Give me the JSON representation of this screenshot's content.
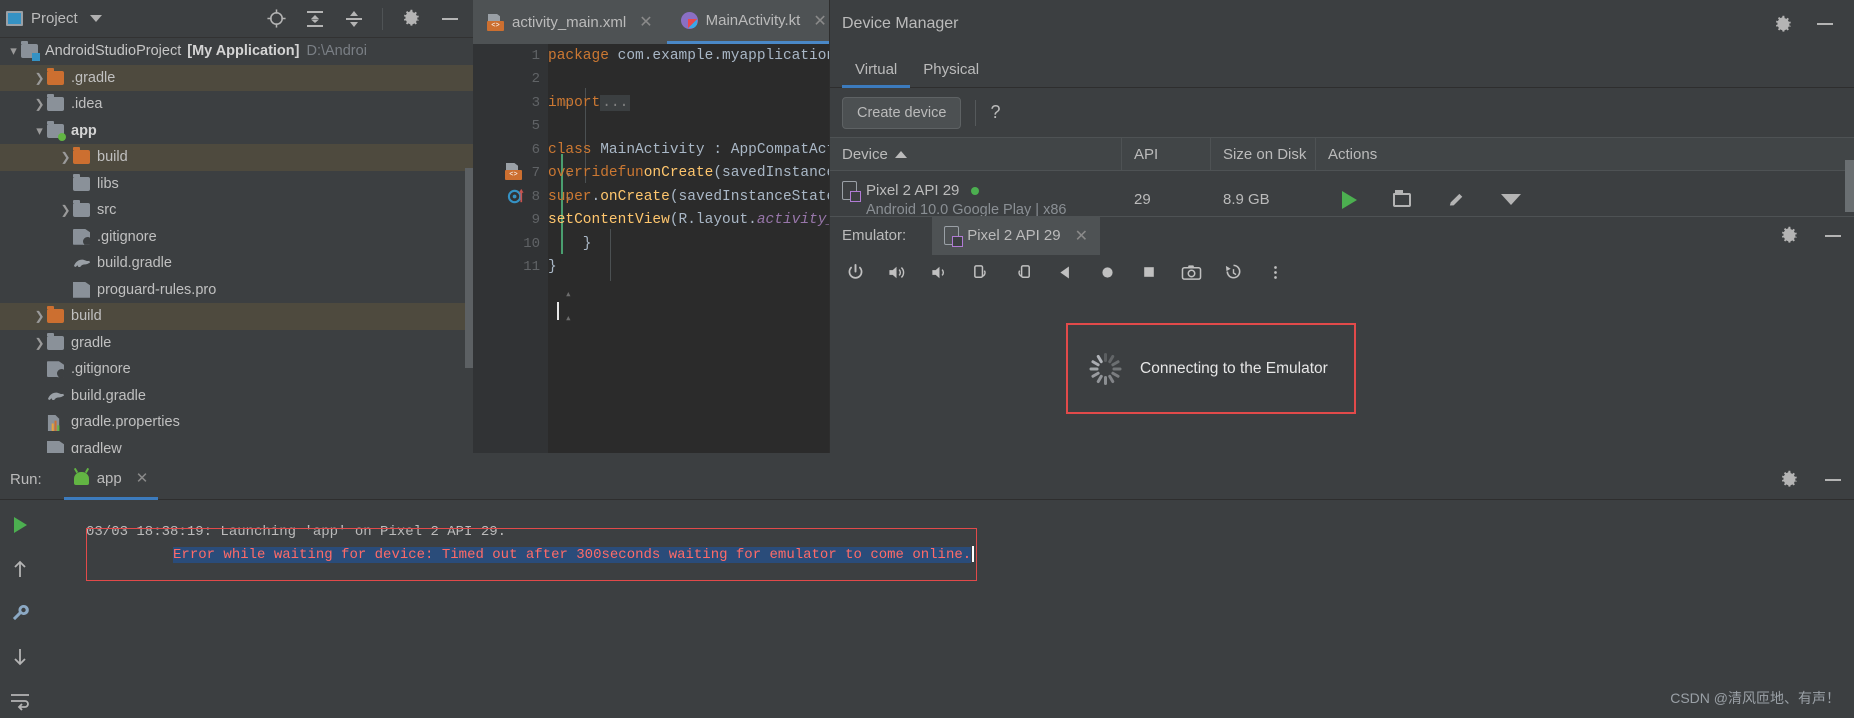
{
  "project_panel": {
    "title": "Project",
    "toolbar_icons": [
      "locate-icon",
      "expand-all-icon",
      "collapse-all-icon",
      "gear-icon",
      "minimize-icon"
    ],
    "root": {
      "name": "AndroidStudioProject",
      "app_name": "[My Application]",
      "path": "D:\\Androi"
    },
    "tree": [
      {
        "label": ".gradle",
        "indent": 1,
        "icon": "folder-orange",
        "arrow": "right",
        "selected": true
      },
      {
        "label": ".idea",
        "indent": 1,
        "icon": "folder-grey",
        "arrow": "right",
        "selected": false
      },
      {
        "label": "app",
        "indent": 1,
        "icon": "folder-grey-green",
        "arrow": "down",
        "selected": false,
        "bold": true
      },
      {
        "label": "build",
        "indent": 2,
        "icon": "folder-orange",
        "arrow": "right",
        "selected": true
      },
      {
        "label": "libs",
        "indent": 2,
        "icon": "folder-grey",
        "arrow": "none",
        "selected": false
      },
      {
        "label": "src",
        "indent": 2,
        "icon": "folder-grey",
        "arrow": "right",
        "selected": false
      },
      {
        "label": ".gitignore",
        "indent": 2,
        "icon": "file-git",
        "arrow": "none",
        "selected": false
      },
      {
        "label": "build.gradle",
        "indent": 2,
        "icon": "file-gradle",
        "arrow": "none",
        "selected": false
      },
      {
        "label": "proguard-rules.pro",
        "indent": 2,
        "icon": "file-doc",
        "arrow": "none",
        "selected": false
      },
      {
        "label": "build",
        "indent": 1,
        "icon": "folder-orange",
        "arrow": "right",
        "selected": true
      },
      {
        "label": "gradle",
        "indent": 1,
        "icon": "folder-grey",
        "arrow": "right",
        "selected": false
      },
      {
        "label": ".gitignore",
        "indent": 1,
        "icon": "file-git",
        "arrow": "none",
        "selected": false
      },
      {
        "label": "build.gradle",
        "indent": 1,
        "icon": "file-gradle",
        "arrow": "none",
        "selected": false
      },
      {
        "label": "gradle.properties",
        "indent": 1,
        "icon": "file-props",
        "arrow": "none",
        "selected": false
      },
      {
        "label": "gradlew",
        "indent": 1,
        "icon": "file-doc",
        "arrow": "none",
        "selected": false
      }
    ]
  },
  "editor": {
    "tabs": [
      {
        "label": "activity_main.xml",
        "icon": "xml-file-icon",
        "active": false,
        "closeable": true
      },
      {
        "label": "MainActivity.kt",
        "icon": "kotlin-file-icon",
        "active": true,
        "closeable": true
      }
    ],
    "inspection_status": "ok-check",
    "line_numbers": [
      "1",
      "2",
      "3",
      "5",
      "6",
      "7",
      "8",
      "9",
      "10",
      "11"
    ],
    "code_lines": [
      "package com.example.myapplication",
      "",
      "import ...",
      "",
      "class MainActivity : AppCompatActivity() {",
      "    override fun onCreate(savedInstanceSta",
      "        super.onCreate(savedInstanceState)",
      "        setContentView(R.layout.activity_m",
      "    }",
      "}"
    ]
  },
  "device_manager": {
    "title": "Device Manager",
    "header_icons": [
      "gear-icon",
      "minimize-icon"
    ],
    "tabs": [
      {
        "label": "Virtual",
        "active": true
      },
      {
        "label": "Physical",
        "active": false
      }
    ],
    "create_device_label": "Create device",
    "help_label": "?",
    "columns": [
      "Device",
      "API",
      "Size on Disk",
      "Actions"
    ],
    "sort_column": "Device",
    "sort_direction": "asc",
    "rows": [
      {
        "device_name": "Pixel 2 API 29",
        "device_sub": "Android 10.0 Google Play | x86",
        "online": true,
        "api": "29",
        "size_on_disk": "8.9 GB",
        "actions": [
          "play-icon",
          "folder-icon",
          "pencil-icon",
          "chevron-down-icon"
        ]
      }
    ]
  },
  "emulator": {
    "label": "Emulator:",
    "tab_label": "Pixel 2 API 29",
    "header_icons": [
      "gear-icon",
      "minimize-icon"
    ],
    "toolbar_icons": [
      "power-icon",
      "volume-up-icon",
      "volume-down-icon",
      "rotate-left-icon",
      "rotate-right-icon",
      "back-icon",
      "home-icon",
      "overview-icon",
      "screenshot-icon",
      "history-icon",
      "more-icon"
    ],
    "status_message": "Connecting to the Emulator",
    "status_border_color": "#e24a4a"
  },
  "run_panel": {
    "label": "Run:",
    "tab_label": "app",
    "header_icons": [
      "gear-icon",
      "minimize-icon"
    ],
    "side_icons": [
      "run-icon",
      "up-arrow-icon",
      "wrench-icon",
      "down-arrow-icon",
      "wrap-text-icon"
    ],
    "console": [
      {
        "text": "03/03 18:38:19: Launching 'app' on Pixel 2 API 29.",
        "style": "normal"
      },
      {
        "text": "Error while waiting for device: Timed out after 300seconds waiting for emulator to come online.",
        "style": "error"
      }
    ]
  },
  "watermark": "CSDN @清风匝地、有声！",
  "colors": {
    "accent_blue": "#3c7bbd",
    "error_red": "#ff6b68",
    "error_border": "#e24a4a",
    "selection_blue": "#2a4c7a",
    "folder_orange": "#cc6f30",
    "online_green": "#4caf50",
    "editor_bg": "#2b2b2b",
    "panel_bg": "#3c3f41"
  }
}
